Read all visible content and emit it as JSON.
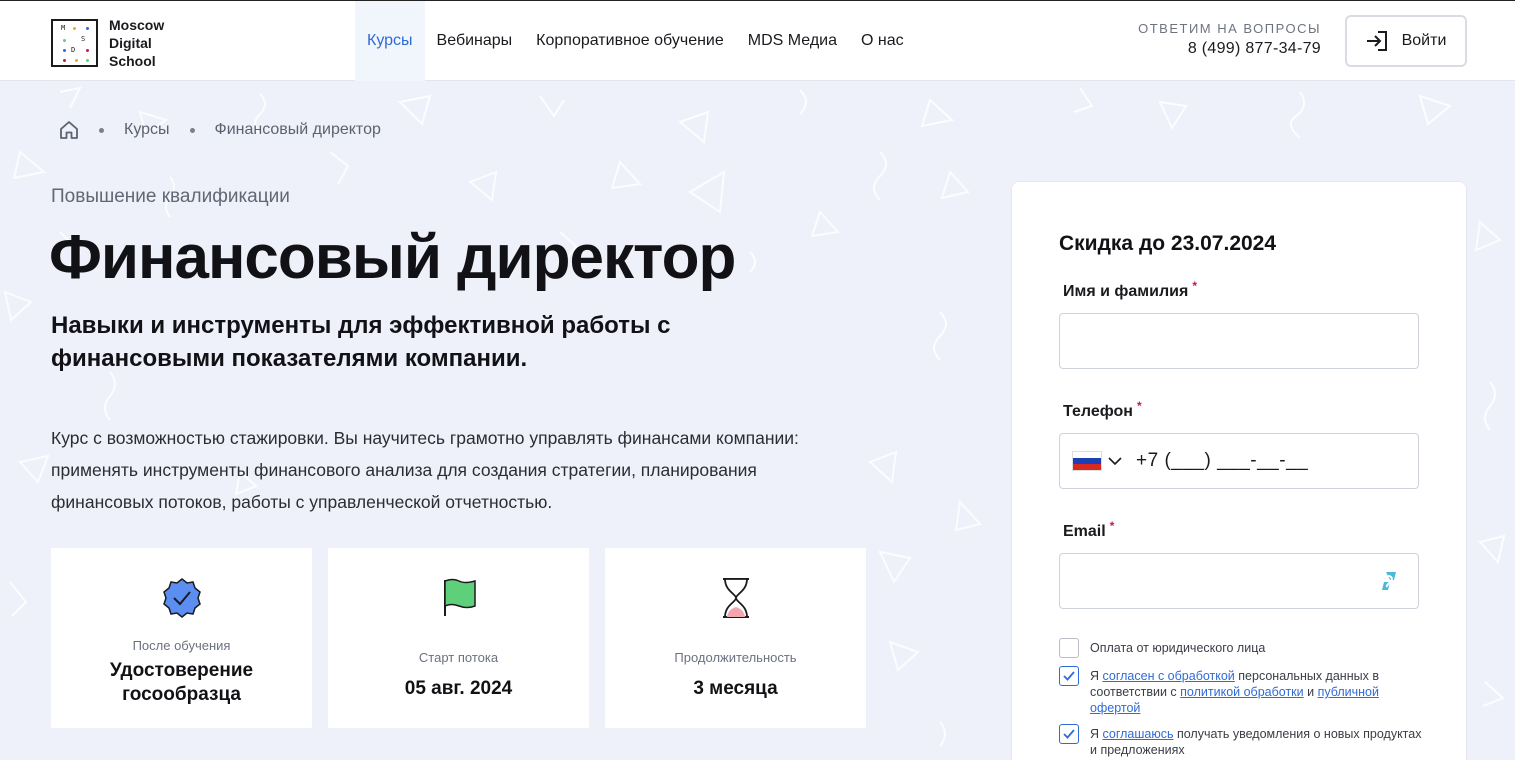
{
  "header": {
    "logo": {
      "line1": "Moscow",
      "line2": "Digital",
      "line3": "School",
      "mark": [
        "M",
        "S",
        "D"
      ]
    },
    "nav": [
      {
        "label": "Курсы",
        "active": true
      },
      {
        "label": "Вебинары",
        "active": false
      },
      {
        "label": "Корпоративное обучение",
        "active": false
      },
      {
        "label": "MDS Медиа",
        "active": false
      },
      {
        "label": "О нас",
        "active": false
      }
    ],
    "contact_label": "ОТВЕТИМ НА ВОПРОСЫ",
    "contact_phone": "8 (499) 877-34-79",
    "login_label": "Войти"
  },
  "breadcrumbs": {
    "home_icon": "home-icon",
    "items": [
      "Курсы",
      "Финансовый директор"
    ]
  },
  "hero": {
    "subtitle": "Повышение квалификации",
    "title": "Финансовый директор",
    "lead": "Навыки и инструменты для эффективной работы с финансовыми показателями компании.",
    "description": "Курс с возможностью стажировки. Вы научитесь грамотно управлять финансами компании: применять инструменты финансового анализа для создания стратегии, планирования финансовых потоков, работы с управленческой отчетностью."
  },
  "cards": [
    {
      "icon": "certificate-badge-icon",
      "label": "После обучения",
      "value": "Удостоверение госообразца"
    },
    {
      "icon": "flag-icon",
      "label": "Старт потока",
      "value": "05 авг. 2024"
    },
    {
      "icon": "hourglass-icon",
      "label": "Продолжительность",
      "value": "3 месяца"
    }
  ],
  "form": {
    "title": "Скидка до 23.07.2024",
    "name_label": "Имя и фамилия",
    "name_value": "",
    "phone_label": "Телефон",
    "phone_mask": "+7 (___) ___-__-__",
    "email_label": "Email",
    "email_value": "",
    "required_mark": "*",
    "checkbox_legal": {
      "label": "Оплата от юридического лица",
      "checked": false
    },
    "checkbox_consent": {
      "checked": true,
      "t1": "Я ",
      "link1": "согласен с обработкой",
      "t2": " персональных данных в соответствии с ",
      "link2": "политикой обработки",
      "t3": " и ",
      "link3": "публичной офертой"
    },
    "checkbox_news": {
      "checked": true,
      "t1": "Я ",
      "link1": "соглашаюсь",
      "t2": " получать уведомления о новых продуктах и предложениях"
    }
  },
  "colors": {
    "accent": "#2f6bd8",
    "required": "#c2185b",
    "background": "#eef1fa",
    "badge": "#5b8ef0",
    "flag_green": "#5fd07a",
    "hourglass_pink": "#f2a7ae"
  }
}
